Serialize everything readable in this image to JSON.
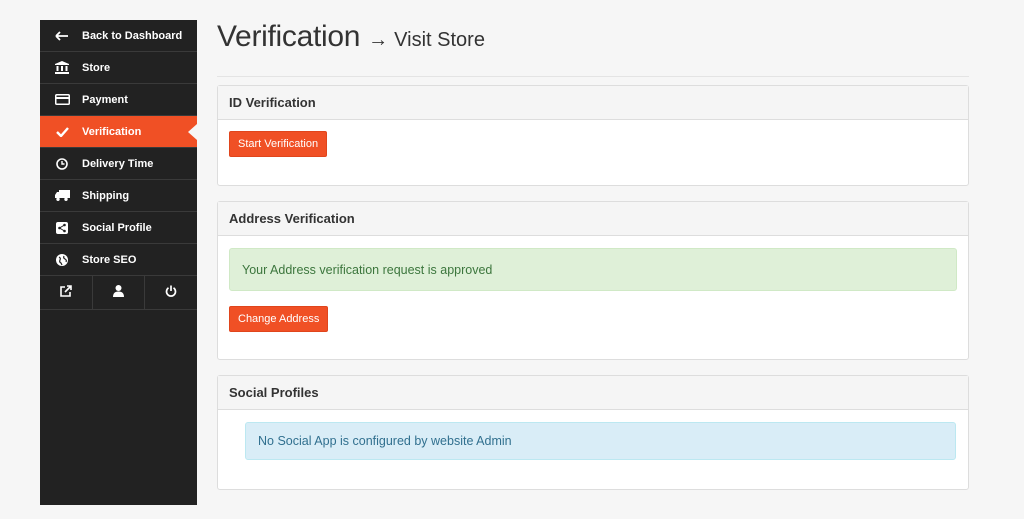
{
  "sidebar": {
    "items": [
      {
        "label": "Back to Dashboard",
        "icon": "arrow-left-icon"
      },
      {
        "label": "Store",
        "icon": "bank-icon"
      },
      {
        "label": "Payment",
        "icon": "credit-card-icon"
      },
      {
        "label": "Verification",
        "icon": "check-icon",
        "active": true
      },
      {
        "label": "Delivery Time",
        "icon": "clock-icon"
      },
      {
        "label": "Shipping",
        "icon": "truck-icon"
      },
      {
        "label": "Social Profile",
        "icon": "share-icon"
      },
      {
        "label": "Store SEO",
        "icon": "globe-icon"
      }
    ],
    "footer_icons": [
      "external-link-icon",
      "user-icon",
      "power-icon"
    ]
  },
  "header": {
    "title": "Verification",
    "arrow": "→",
    "visit_store": "Visit Store"
  },
  "id_verification": {
    "heading": "ID Verification",
    "button": "Start Verification"
  },
  "address_verification": {
    "heading": "Address Verification",
    "alert": "Your Address verification request is approved",
    "button": "Change Address"
  },
  "social_profiles": {
    "heading": "Social Profiles",
    "alert": "No Social App is configured by website Admin"
  },
  "colors": {
    "accent": "#f05025",
    "sidebar_bg": "#222222",
    "success_bg": "#dff0d8",
    "info_bg": "#d9edf7"
  }
}
